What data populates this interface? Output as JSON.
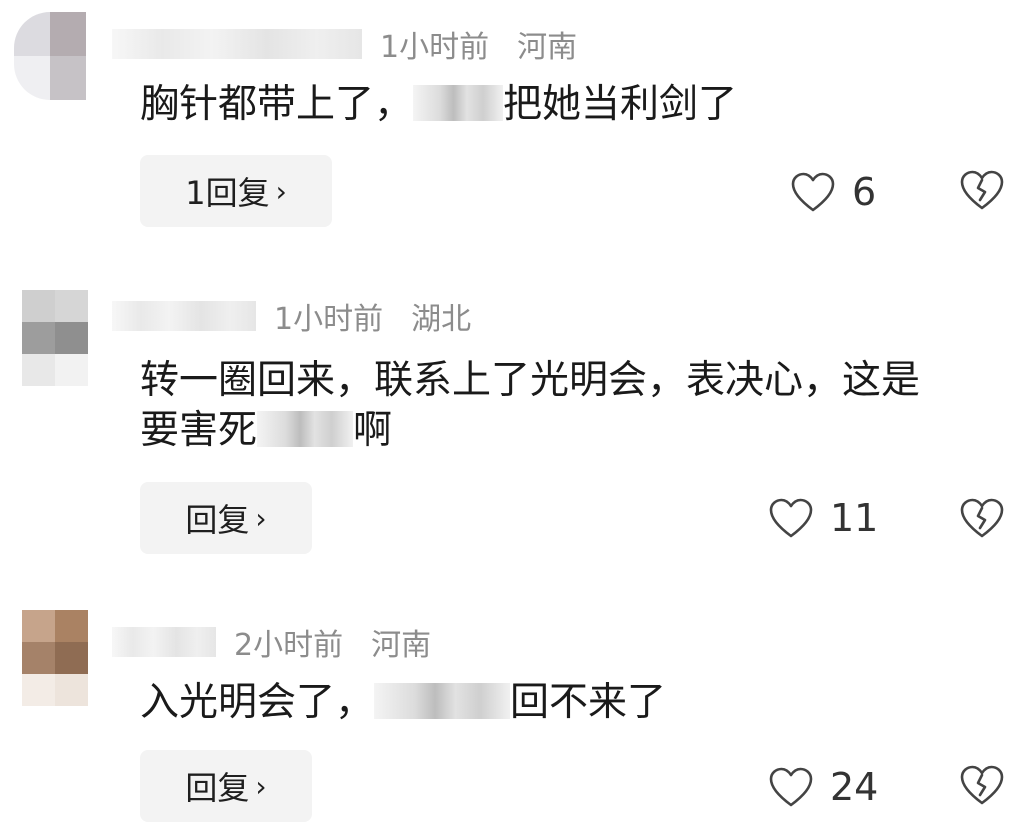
{
  "comments": [
    {
      "time": "1小时前",
      "location": "河南",
      "text_before": "胸针都带上了，",
      "text_after": "把她当利剑了",
      "text_line2_before": "",
      "text_line2_after": "",
      "reply_label": "1回复",
      "like_count": "6"
    },
    {
      "time": "1小时前",
      "location": "湖北",
      "text_before": "转一圈回来，联系上了光明会，表决心，这是",
      "text_after": "",
      "text_line2_before": "要害死",
      "text_line2_after": "啊",
      "reply_label": "回复",
      "like_count": "11"
    },
    {
      "time": "2小时前",
      "location": "河南",
      "text_before": "入光明会了，",
      "text_after": "回不来了",
      "text_line2_before": "",
      "text_line2_after": "",
      "reply_label": "回复",
      "like_count": "24"
    }
  ],
  "icons": {
    "like": "heart-outline-icon",
    "dislike": "broken-heart-icon",
    "reply_chevron": "chevron-right-icon"
  },
  "colors": {
    "meta_text": "#8c8c8c",
    "body_text": "#1a1a1a",
    "reply_bg": "#f3f3f3",
    "icon_stroke": "#444444"
  }
}
